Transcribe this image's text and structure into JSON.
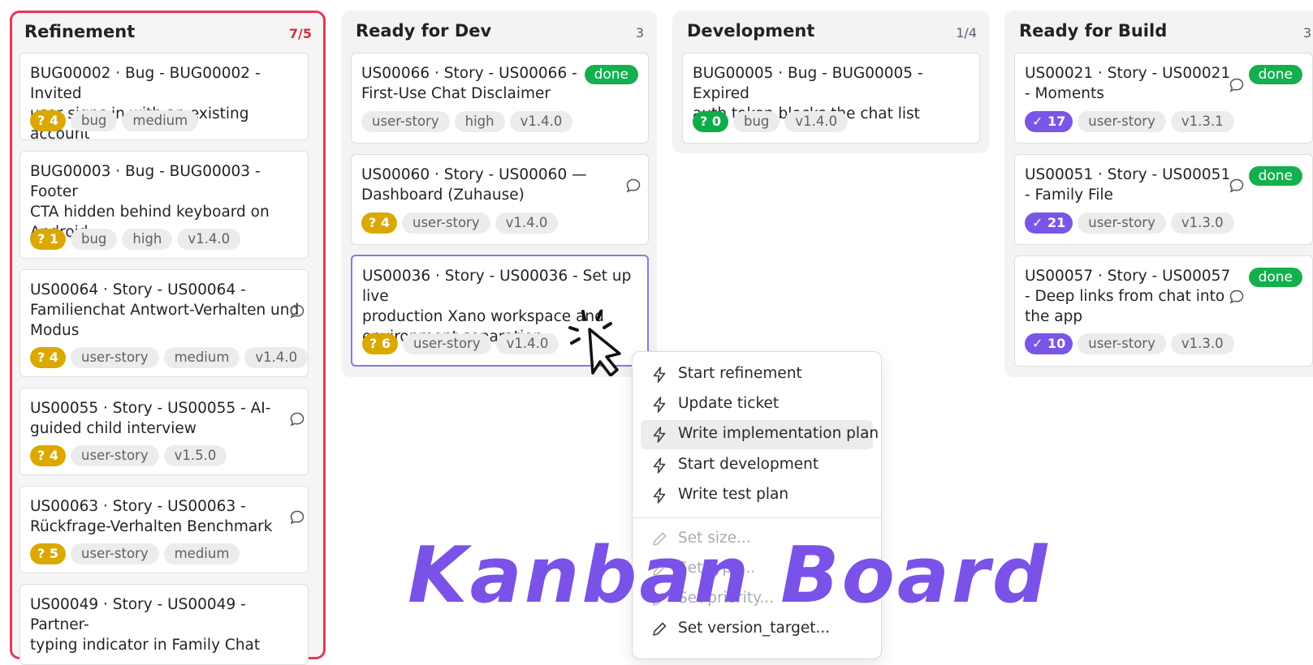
{
  "columns": {
    "refinement": {
      "title": "Refinement",
      "count": "7/5",
      "cards": [
        {
          "title_line1": "BUG00002 · Bug - BUG00002 - Invited",
          "title_line2": "user signs in with an existing account",
          "badge": "? 4",
          "tags": [
            "bug",
            "medium"
          ]
        },
        {
          "title_line1": "BUG00003 · Bug - BUG00003 - Footer",
          "title_line2": "CTA hidden behind keyboard on",
          "title_line3": "Android",
          "badge": "? 1",
          "tags": [
            "bug",
            "high",
            "v1.4.0"
          ]
        },
        {
          "title_line1": "US00064 · Story - US00064 -",
          "title_line2": "Familienchat Antwort-Verhalten und",
          "title_line3": "Modus",
          "badge": "? 4",
          "tags": [
            "user-story",
            "medium",
            "v1.4.0"
          ]
        },
        {
          "title_line1": "US00055 · Story - US00055 - AI-",
          "title_line2": "guided child interview",
          "badge": "? 4",
          "tags": [
            "user-story",
            "v1.5.0"
          ]
        },
        {
          "title_line1": "US00063 · Story - US00063 -",
          "title_line2": "Rückfrage-Verhalten Benchmark",
          "badge": "? 5",
          "tags": [
            "user-story",
            "medium"
          ]
        },
        {
          "title_line1": "US00049 · Story - US00049 - Partner-",
          "title_line2": "typing indicator in Family Chat"
        }
      ]
    },
    "ready_dev": {
      "title": "Ready for Dev",
      "count": "3",
      "cards": [
        {
          "title_line1": "US00066 · Story - US00066 -",
          "title_line2": "First-Use Chat Disclaimer",
          "status": "done",
          "tags": [
            "user-story",
            "high",
            "v1.4.0"
          ]
        },
        {
          "title_line1": "US00060 · Story - US00060 —",
          "title_line2": "Dashboard (Zuhause)",
          "badge": "? 4",
          "tags": [
            "user-story",
            "v1.4.0"
          ]
        },
        {
          "title_line1": "US00036 · Story - US00036 - Set up live",
          "title_line2": "production Xano workspace and",
          "title_line3": "environment separation",
          "badge": "? 6",
          "tags": [
            "user-story",
            "v1.4.0"
          ]
        }
      ]
    },
    "development": {
      "title": "Development",
      "count": "1/4",
      "cards": [
        {
          "title_line1": "BUG00005 · Bug - BUG00005 - Expired",
          "title_line2": "auth token blocks the chat list",
          "badge": "? 0",
          "tags": [
            "bug",
            "v1.4.0"
          ]
        }
      ]
    },
    "ready_build": {
      "title": "Ready for Build",
      "count": "3",
      "cards": [
        {
          "title_line1": "US00021 · Story - US00021",
          "title_line2": "- Moments",
          "status": "done",
          "badge": "✓ 17",
          "tags": [
            "user-story",
            "v1.3.1"
          ]
        },
        {
          "title_line1": "US00051 · Story - US00051",
          "title_line2": "- Family File",
          "status": "done",
          "badge": "✓ 21",
          "tags": [
            "user-story",
            "v1.3.0"
          ]
        },
        {
          "title_line1": "US00057 · Story - US00057",
          "title_line2": "- Deep links from chat into",
          "title_line3": "the app",
          "status": "done",
          "badge": "✓ 10",
          "tags": [
            "user-story",
            "v1.3.0"
          ]
        }
      ]
    }
  },
  "context_menu": {
    "items": [
      {
        "label": "Start refinement"
      },
      {
        "label": "Update ticket"
      },
      {
        "label": "Write implementation plan"
      },
      {
        "label": "Start development"
      },
      {
        "label": "Write test plan"
      }
    ],
    "edit_items": [
      {
        "label": "Set size..."
      },
      {
        "label": "Set type..."
      },
      {
        "label": "Set priority..."
      },
      {
        "label": "Set version_target..."
      }
    ]
  },
  "overlay_title": "Kanban Board",
  "colors": {
    "wip_exceeded": "#e8394f",
    "badge_estimate": "#dba800",
    "badge_zero": "#0ead4a",
    "badge_done": "#7a56e6",
    "status_done": "#13b04d",
    "overlay": "#7a52e8"
  },
  "icons": {
    "comment": "comment-icon",
    "action": "lightning-icon",
    "edit": "pencil-icon",
    "cursor": "pointer-cursor-icon"
  }
}
